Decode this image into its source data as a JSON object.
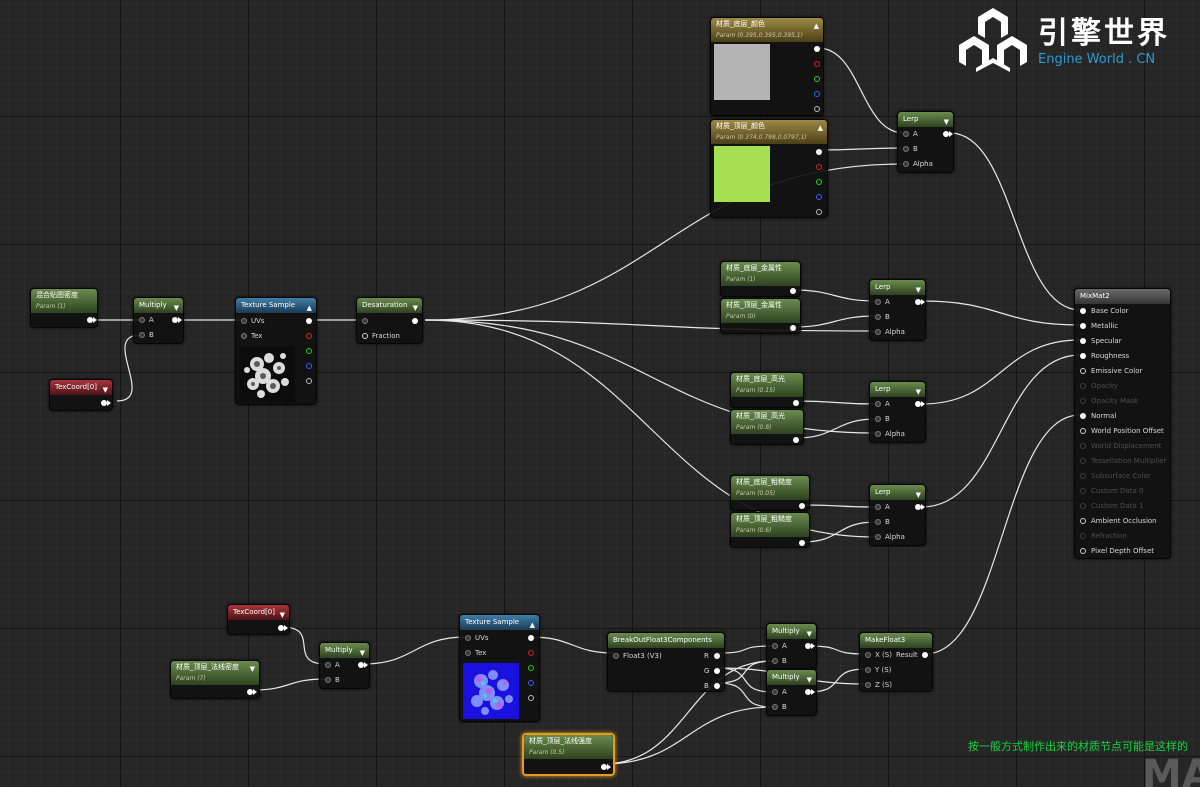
{
  "brand": {
    "title": "引擎世界",
    "subtitle": "Engine World . CN"
  },
  "caption": "按一般方式制作出来的材质节点可能是这样的",
  "watermark": "MA",
  "nodes": {
    "base_color_bottom": {
      "title": "材质_底层_颜色",
      "sub": "Param (0.395,0.395,0.395,1)"
    },
    "base_color_top": {
      "title": "材质_顶层_颜色",
      "sub": "Param (0.374,0.798,0.0797,1)"
    },
    "blend_density": {
      "title": "混合贴图密度",
      "sub": "Param (1)"
    },
    "multiply": "Multiply",
    "texture_sample": "Texture Sample",
    "desaturation": "Desaturation",
    "texcoord": "TexCoord[0]",
    "lerp": "Lerp",
    "metal_bottom": {
      "title": "材质_底层_金属性",
      "sub": "Param (1)"
    },
    "metal_top": {
      "title": "材质_顶层_金属性",
      "sub": "Param (0)"
    },
    "spec_bottom": {
      "title": "材质_底层_高光",
      "sub": "Param (0.15)"
    },
    "spec_top": {
      "title": "材质_顶层_高光",
      "sub": "Param (0.8)"
    },
    "rough_bottom": {
      "title": "材质_底层_粗糙度",
      "sub": "Param (0.05)"
    },
    "rough_top": {
      "title": "材质_顶层_粗糙度",
      "sub": "Param (0.6)"
    },
    "normal_density": {
      "title": "材质_顶层_法线密度",
      "sub": "Param (7)"
    },
    "breakout": "BreakOutFloat3Components",
    "makefloat": "MakeFloat3",
    "normal_strength": {
      "title": "材质_顶层_法线强度",
      "sub": "Param (0.5)"
    },
    "mixmat": "MixMat2"
  },
  "pins": {
    "A": "A",
    "B": "B",
    "Alpha": "Alpha",
    "UVs": "UVs",
    "Tex": "Tex",
    "Fraction": "Fraction",
    "R": "R",
    "G": "G",
    "Bc": "B",
    "float3": "Float3 (V3)",
    "X": "X (S)",
    "Y": "Y (S)",
    "Z": "Z (S)",
    "Result": "Result"
  },
  "mixmat_inputs": [
    {
      "label": "Base Color",
      "active": true
    },
    {
      "label": "Metallic",
      "active": true
    },
    {
      "label": "Specular",
      "active": true
    },
    {
      "label": "Roughness",
      "active": true
    },
    {
      "label": "Emissive Color",
      "active": true
    },
    {
      "label": "Opacity",
      "active": false
    },
    {
      "label": "Opacity Mask",
      "active": false
    },
    {
      "label": "Normal",
      "active": true
    },
    {
      "label": "World Position Offset",
      "active": true
    },
    {
      "label": "World Displacement",
      "active": false
    },
    {
      "label": "Tessellation Multiplier",
      "active": false
    },
    {
      "label": "Subsurface Color",
      "active": false
    },
    {
      "label": "Custom Data 0",
      "active": false
    },
    {
      "label": "Custom Data 1",
      "active": false
    },
    {
      "label": "Ambient Occlusion",
      "active": true
    },
    {
      "label": "Refraction",
      "active": false
    },
    {
      "label": "Pixel Depth Offset",
      "active": true
    }
  ],
  "colors": {
    "swatch_bottom": "#b4b4b4",
    "swatch_top": "#a4e052",
    "wire": "#e8e8e8",
    "caption": "#19d23f",
    "brand_sub": "#2e9bd6",
    "selected_border": "#e89a1c"
  },
  "icons": [
    "collapse-arrow-icon",
    "brand-logo-icon"
  ]
}
